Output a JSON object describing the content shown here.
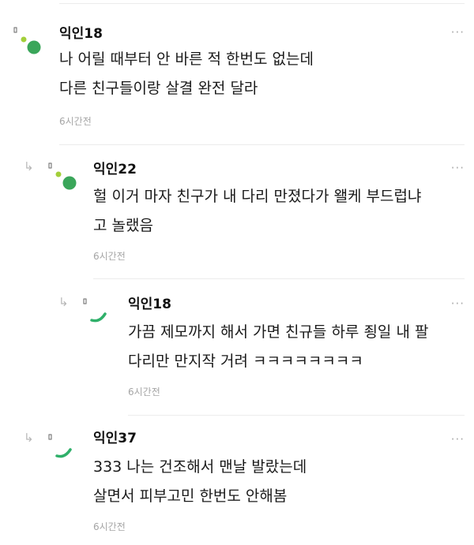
{
  "comments": [
    {
      "author": "익인18",
      "lines": [
        "나 어릴 때부터 안 바른 적 한번도 없는데",
        "다른 친구들이랑 살결 완전 달라"
      ],
      "time": "6시간전",
      "avatar_icon": "dots-avatar-icon",
      "more_label": "···"
    },
    {
      "author": "익인22",
      "lines": [
        "헐 이거 마자 친구가 내 다리 만졌다가 왤케 부드럽냐",
        "고 놀랬음"
      ],
      "time": "6시간전",
      "avatar_icon": "dots-avatar-icon",
      "more_label": "···"
    },
    {
      "author": "익인18",
      "lines": [
        "가끔 제모까지 해서 가면 친규들 하루 죙일 내 팔",
        "다리만 만지작 거려 ㅋㅋㅋㅋㅋㅋㅋㅋ"
      ],
      "time": "6시간전",
      "avatar_icon": "arc-avatar-icon",
      "more_label": "···"
    },
    {
      "author": "익인37",
      "lines": [
        "333 나는 건조해서 맨날 발랐는데",
        "살면서 피부고민 한번도 안해봄"
      ],
      "time": "6시간전",
      "avatar_icon": "arc-avatar-icon",
      "more_label": "···"
    }
  ],
  "colors": {
    "avatar_green": "#3aa65a",
    "avatar_lime": "#a3cf3a",
    "avatar_arc": "#2fb06a"
  }
}
